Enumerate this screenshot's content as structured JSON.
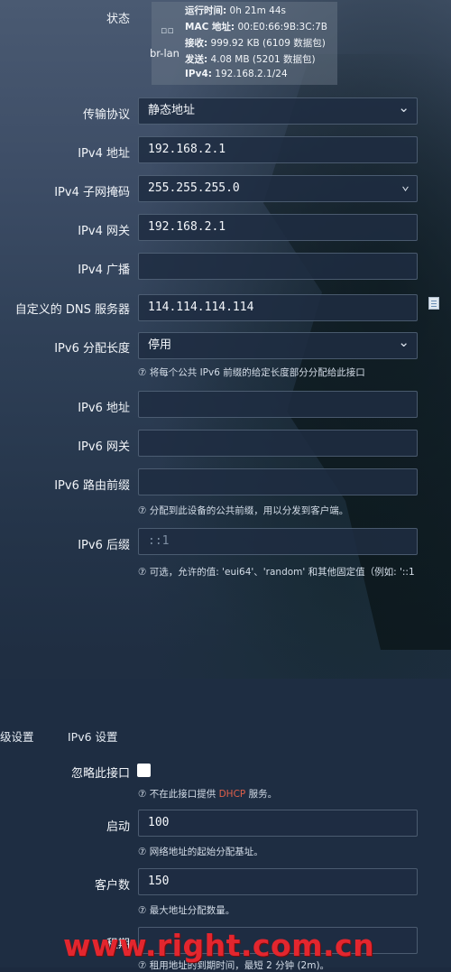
{
  "status": {
    "label": "状态",
    "iface_icon": "network-interface-icon",
    "iface_name": "br-lan",
    "uptime_label": "运行时间:",
    "uptime_value": "0h 21m 44s",
    "mac_label": "MAC 地址:",
    "mac_value": "00:E0:66:9B:3C:7B",
    "rx_label": "接收:",
    "rx_value": "999.92 KB (6109 数据包)",
    "tx_label": "发送:",
    "tx_value": "4.08 MB (5201 数据包)",
    "ipv4_label": "IPv4:",
    "ipv4_value": "192.168.2.1/24"
  },
  "form": {
    "protocol_label": "传输协议",
    "protocol_value": "静态地址",
    "ipv4_addr_label": "IPv4 地址",
    "ipv4_addr_value": "192.168.2.1",
    "netmask_label": "IPv4 子网掩码",
    "netmask_value": "255.255.255.0",
    "gateway_label": "IPv4 网关",
    "gateway_value": "192.168.2.1",
    "broadcast_label": "IPv4 广播",
    "broadcast_value": "",
    "dns_label": "自定义的 DNS 服务器",
    "dns_value": "114.114.114.114",
    "ipv6_assign_label": "IPv6 分配长度",
    "ipv6_assign_value": "停用",
    "ipv6_assign_hint": "⑦ 将每个公共 IPv6 前缀的给定长度部分分配给此接口",
    "ipv6_addr_label": "IPv6 地址",
    "ipv6_addr_value": "",
    "ipv6_gw_label": "IPv6 网关",
    "ipv6_gw_value": "",
    "ipv6_prefix_label": "IPv6 路由前缀",
    "ipv6_prefix_value": "",
    "ipv6_prefix_hint": "⑦ 分配到此设备的公共前缀，用以分发到客户端。",
    "ipv6_suffix_label": "IPv6 后缀",
    "ipv6_suffix_placeholder": "::1",
    "ipv6_suffix_hint": "⑦ 可选，允许的值: 'eui64'、'random' 和其他固定值（例如: '::1"
  },
  "dhcp": {
    "tab_advanced": "级设置",
    "tab_ipv6": "IPv6 设置",
    "ignore_label": "忽略此接口",
    "ignore_hint_pre": "⑦ 不在此接口提供 ",
    "ignore_hint_link": "DHCP",
    "ignore_hint_post": " 服务。",
    "start_label": "启动",
    "start_value": "100",
    "start_hint": "⑦ 网络地址的起始分配基址。",
    "limit_label": "客户数",
    "limit_value": "150",
    "limit_hint": "⑦ 最大地址分配数量。",
    "lease_label": "租期",
    "lease_hint": "⑦ 租用地址的到期时间，最短 2 分钟 (2m)。"
  },
  "watermark": "www.right.com.cn"
}
